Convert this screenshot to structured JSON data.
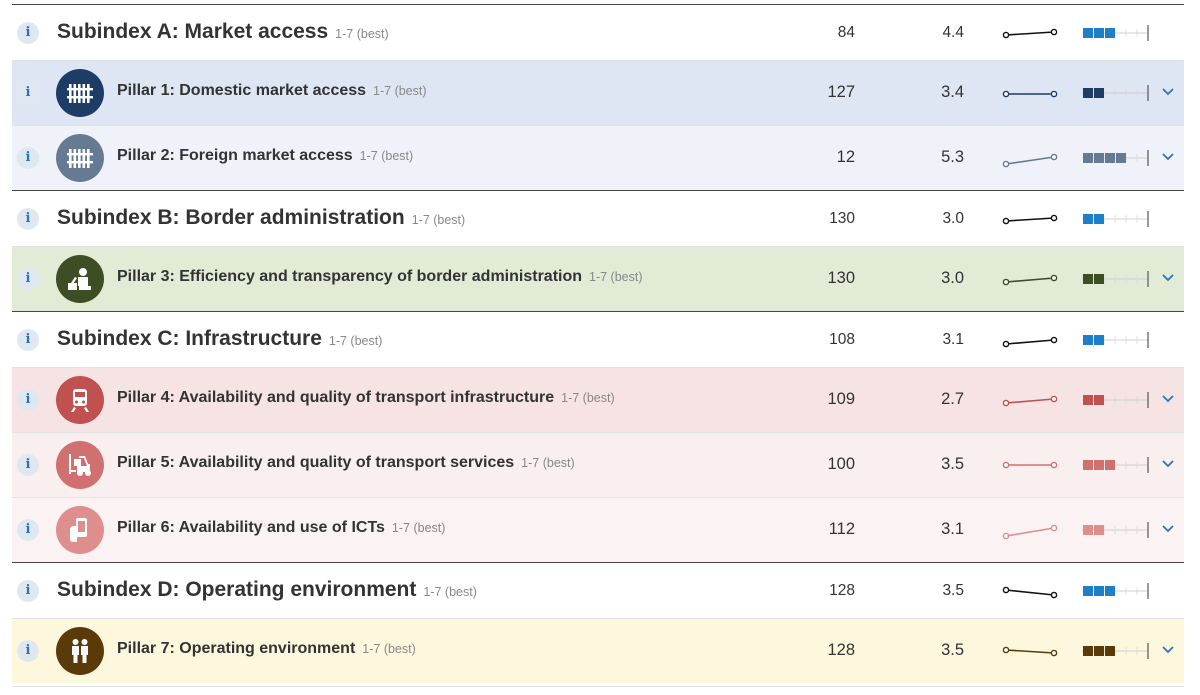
{
  "rows": [
    {
      "kind": "sub",
      "title": "Subindex A: Market access",
      "scale": "1-7 (best)",
      "rank": "84",
      "score": "4.4",
      "color": "#1e7ec8",
      "trend": [
        0.45,
        0.6
      ],
      "segments": 3,
      "bg": "#ffffff"
    },
    {
      "kind": "pil",
      "title": "Pillar 1: Domestic market access",
      "scale": "1-7 (best)",
      "rank": "127",
      "score": "3.4",
      "color": "#1e3d66",
      "trend": [
        0.45,
        0.45
      ],
      "segments": 2,
      "bg": "#dde6f2",
      "icon": "fence-icon"
    },
    {
      "kind": "pil",
      "title": "Pillar 2: Foreign market access",
      "scale": "1-7 (best)",
      "rank": "12",
      "score": "5.3",
      "color": "#667a94",
      "trend": [
        0.2,
        0.55
      ],
      "segments": 4,
      "bg": "#eff3f9",
      "icon": "fence-icon"
    },
    {
      "kind": "sub",
      "title": "Subindex B: Border administration",
      "scale": "1-7 (best)",
      "rank": "130",
      "score": "3.0",
      "color": "#1e7ec8",
      "trend": [
        0.45,
        0.6
      ],
      "segments": 2,
      "bg": "#ffffff"
    },
    {
      "kind": "pil",
      "title": "Pillar 3: Efficiency and transparency of border administration",
      "scale": "1-7 (best)",
      "rank": "130",
      "score": "3.0",
      "color": "#3d4d24",
      "trend": [
        0.35,
        0.55
      ],
      "segments": 2,
      "bg": "#e2ebd6",
      "icon": "customs-officer-icon"
    },
    {
      "kind": "sub",
      "title": "Subindex C: Infrastructure",
      "scale": "1-7 (best)",
      "rank": "108",
      "score": "3.1",
      "color": "#1e7ec8",
      "trend": [
        0.35,
        0.55
      ],
      "segments": 2,
      "bg": "#ffffff"
    },
    {
      "kind": "pil",
      "title": "Pillar 4: Availability and quality of transport infrastructure",
      "scale": "1-7 (best)",
      "rank": "109",
      "score": "2.7",
      "color": "#c15050",
      "trend": [
        0.35,
        0.55
      ],
      "segments": 2,
      "bg": "#f6e4e4",
      "icon": "train-icon"
    },
    {
      "kind": "pil",
      "title": "Pillar 5: Availability and quality of transport services",
      "scale": "1-7 (best)",
      "rank": "100",
      "score": "3.5",
      "color": "#d07070",
      "trend": [
        0.5,
        0.5
      ],
      "segments": 3,
      "bg": "#f9efef",
      "icon": "forklift-icon"
    },
    {
      "kind": "pil",
      "title": "Pillar 6: Availability and use of ICTs",
      "scale": "1-7 (best)",
      "rank": "112",
      "score": "3.1",
      "color": "#df8e8e",
      "trend": [
        0.2,
        0.6
      ],
      "segments": 2,
      "bg": "#fbf3f3",
      "icon": "phone-hand-icon"
    },
    {
      "kind": "sub",
      "title": "Subindex D: Operating environment",
      "scale": "1-7 (best)",
      "rank": "128",
      "score": "3.5",
      "color": "#1e7ec8",
      "trend": [
        0.6,
        0.35
      ],
      "segments": 3,
      "bg": "#ffffff"
    },
    {
      "kind": "pil",
      "title": "Pillar 7: Operating environment",
      "scale": "1-7 (best)",
      "rank": "128",
      "score": "3.5",
      "color": "#5a3a08",
      "trend": [
        0.55,
        0.4
      ],
      "segments": 3,
      "bg": "#fdf7dd",
      "icon": "business-people-icon"
    }
  ],
  "info_glyph": "i"
}
